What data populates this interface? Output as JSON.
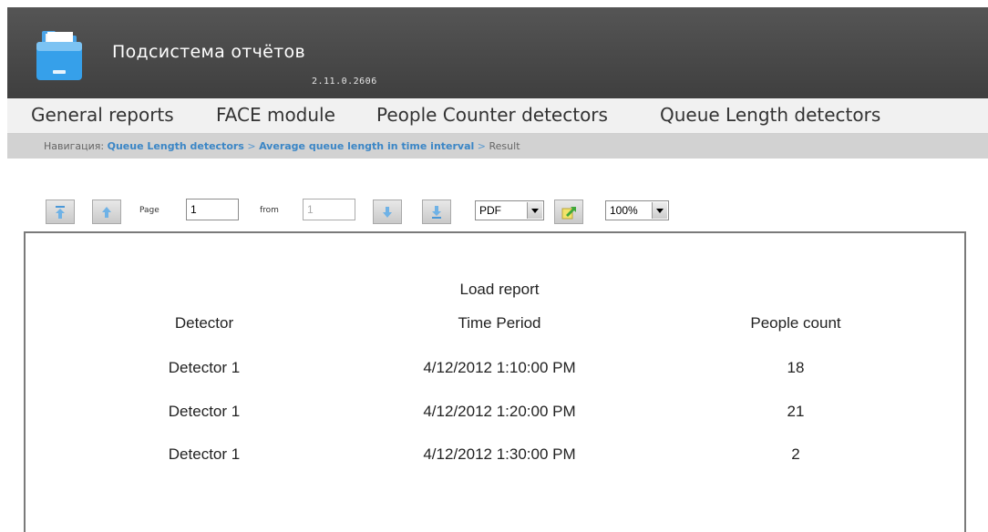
{
  "header": {
    "title": "Подсистема отчётов",
    "version": "2.11.0.2606"
  },
  "menu": {
    "items": [
      {
        "label": "General reports"
      },
      {
        "label": "FACE module"
      },
      {
        "label": "People Counter detectors"
      },
      {
        "label": "Queue Length detectors"
      }
    ]
  },
  "breadcrumb": {
    "prefix": "Навигация: ",
    "crumbs": [
      "Queue Length detectors",
      "Average queue length in time interval"
    ],
    "separator": " > ",
    "current": "Result"
  },
  "toolbar": {
    "page_label": "Page",
    "page_value": "1",
    "from_label": "from",
    "from_value": "1",
    "format_value": "PDF",
    "zoom_value": "100%"
  },
  "report": {
    "title": "Load report",
    "columns": [
      "Detector",
      "Time Period",
      "People count"
    ],
    "rows": [
      [
        "Detector 1",
        "4/12/2012 1:10:00 PM",
        "18"
      ],
      [
        "Detector 1",
        "4/12/2012 1:20:00 PM",
        "21"
      ],
      [
        "Detector 1",
        "4/12/2012 1:30:00 PM",
        "2"
      ]
    ]
  }
}
